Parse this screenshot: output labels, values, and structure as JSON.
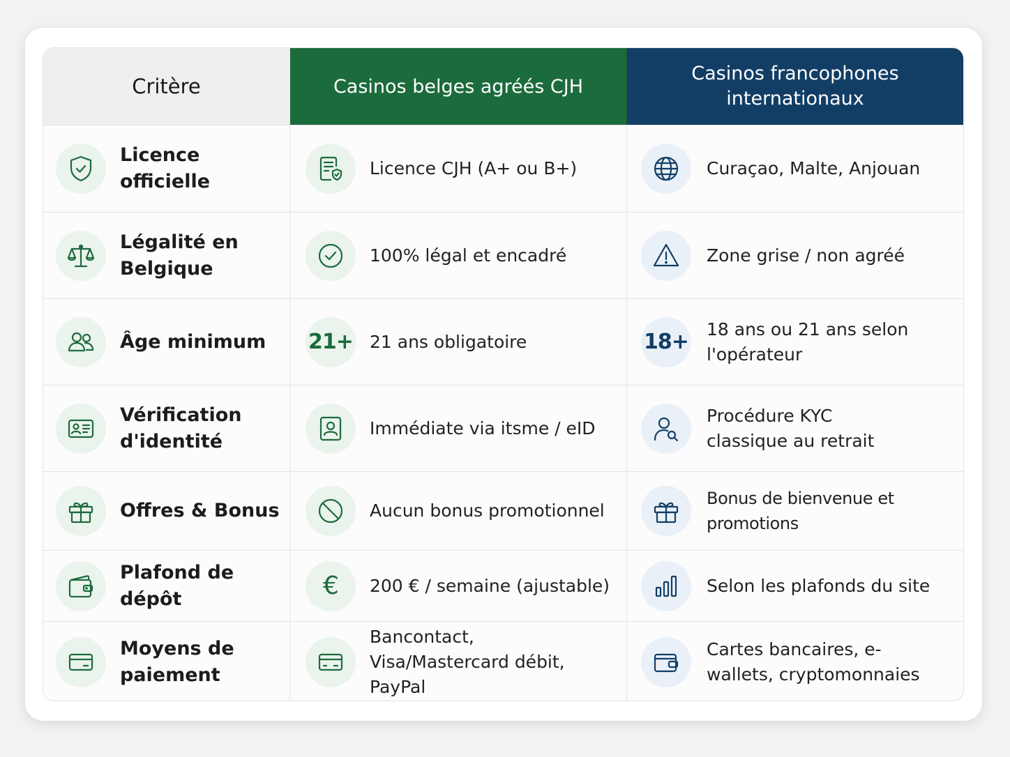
{
  "header": {
    "criterion": "Critère",
    "belgian": "Casinos belges agréés CJH",
    "international": "Casinos francophones internationaux"
  },
  "colors": {
    "green": "#1c6b3c",
    "navy": "#123e66"
  },
  "rows": [
    {
      "criterion": "Licence officielle",
      "criterion_icon": "shield-check-icon",
      "belgian": "Licence CJH (A+ ou B+)",
      "belgian_icon": "document-shield-icon",
      "international": "Curaçao, Malte, Anjouan",
      "international_icon": "globe-icon"
    },
    {
      "criterion": "Légalité en Belgique",
      "criterion_icon": "scales-icon",
      "belgian": "100% légal et encadré",
      "belgian_icon": "check-circle-icon",
      "international": "Zone grise / non agréé",
      "international_icon": "warning-triangle-icon"
    },
    {
      "criterion": "Âge minimum",
      "criterion_icon": "users-icon",
      "belgian": "21 ans obligatoire",
      "belgian_icon_text": "21+",
      "international": "18 ans ou 21 ans selon l'opérateur",
      "international_icon_text": "18+"
    },
    {
      "criterion": "Vérification d'identité",
      "criterion_icon": "id-card-icon",
      "belgian": "Immédiate via itsme / eID",
      "belgian_icon": "user-badge-icon",
      "international": "Procédure KYC classique au retrait",
      "international_icon": "user-search-icon"
    },
    {
      "criterion": "Offres & Bonus",
      "criterion_icon": "gift-icon",
      "belgian": "Aucun bonus promotionnel",
      "belgian_icon": "prohibited-icon",
      "international": "Bonus de bienvenue et promotions",
      "international_icon": "gift-icon"
    },
    {
      "criterion": "Plafond de dépôt",
      "criterion_icon": "wallet-icon",
      "belgian": "200 € / semaine (ajustable)",
      "belgian_icon_text": "€",
      "international": "Selon les plafonds du site",
      "international_icon": "bar-chart-icon"
    },
    {
      "criterion": "Moyens de paiement",
      "criterion_icon": "credit-card-icon",
      "belgian": "Bancontact, Visa/Mastercard débit, PayPal",
      "belgian_icon": "credit-card-icon",
      "international": "Cartes bancaires, e-wallets, cryptomonnaies",
      "international_icon": "wallet-icon"
    }
  ]
}
